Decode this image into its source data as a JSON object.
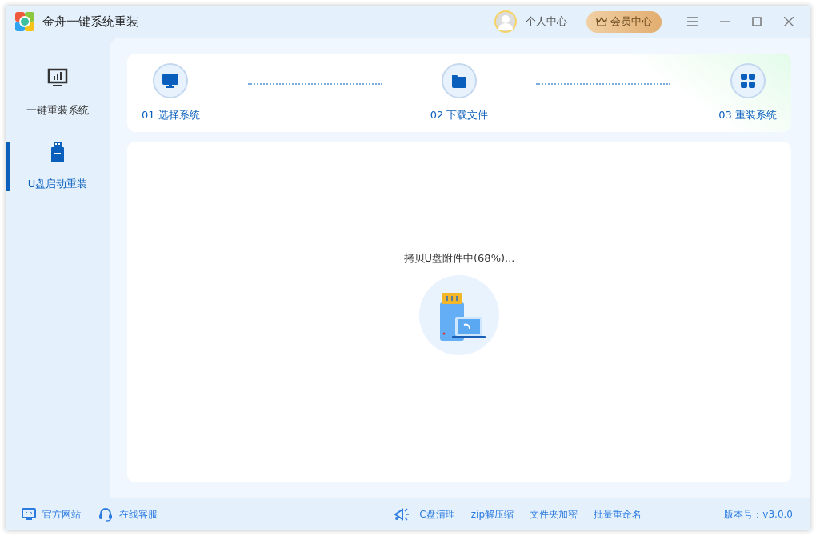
{
  "window": {
    "title": "金舟一键系统重装"
  },
  "header": {
    "user": "个人中心",
    "vip": "会员中心"
  },
  "sidebar": {
    "items": [
      {
        "label": "一键重装系统",
        "kind": "monitor",
        "selected": false
      },
      {
        "label": "U盘启动重装",
        "kind": "usb",
        "selected": true
      }
    ]
  },
  "steps": [
    {
      "label": "01 选择系统",
      "kind": "monitor"
    },
    {
      "label": "02 下载文件",
      "kind": "folder"
    },
    {
      "label": "03 重装系统",
      "kind": "grid"
    }
  ],
  "status": {
    "text": "拷贝U盘附件中(68%)..."
  },
  "footer": {
    "links": [
      {
        "label": "官方网站",
        "kind": "web"
      },
      {
        "label": "在线客服",
        "kind": "headset"
      }
    ],
    "tools": [
      {
        "label": "C盘清理",
        "kind": "clean"
      },
      {
        "label": "zip解压缩"
      },
      {
        "label": "文件夹加密"
      },
      {
        "label": "批量重命名"
      }
    ],
    "version": "版本号：v3.0.0"
  }
}
